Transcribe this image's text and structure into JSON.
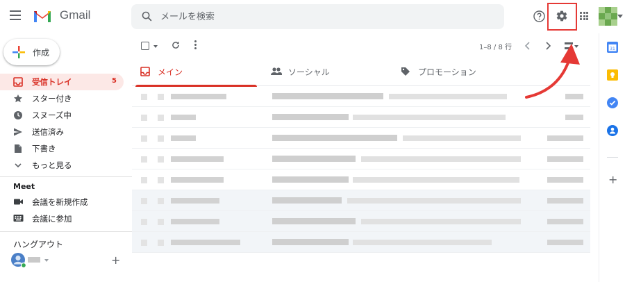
{
  "header": {
    "app_name": "Gmail",
    "search_placeholder": "メールを検索"
  },
  "compose": {
    "label": "作成"
  },
  "nav": [
    {
      "label": "受信トレイ",
      "count": "5",
      "icon": "inbox-icon",
      "active": true
    },
    {
      "label": "スター付き",
      "icon": "star-icon"
    },
    {
      "label": "スヌーズ中",
      "icon": "clock-icon"
    },
    {
      "label": "送信済み",
      "icon": "send-icon"
    },
    {
      "label": "下書き",
      "icon": "draft-icon"
    },
    {
      "label": "もっと見る",
      "icon": "chevron-down-icon"
    }
  ],
  "meet": {
    "title": "Meet",
    "items": [
      {
        "label": "会議を新規作成",
        "icon": "videocam-icon"
      },
      {
        "label": "会議に参加",
        "icon": "keyboard-icon"
      }
    ]
  },
  "hangouts": {
    "title": "ハングアウト"
  },
  "toolbar": {
    "pager": "1–8 / 8 行"
  },
  "tabs": [
    {
      "label": "メイン",
      "icon": "inbox-tab-icon",
      "active": true
    },
    {
      "label": "ソーシャル",
      "icon": "people-icon"
    },
    {
      "label": "プロモーション",
      "icon": "tag-icon"
    }
  ],
  "colors": {
    "accent": "#d93025",
    "highlight_box": "#e53935",
    "arrow": "#e53935"
  }
}
